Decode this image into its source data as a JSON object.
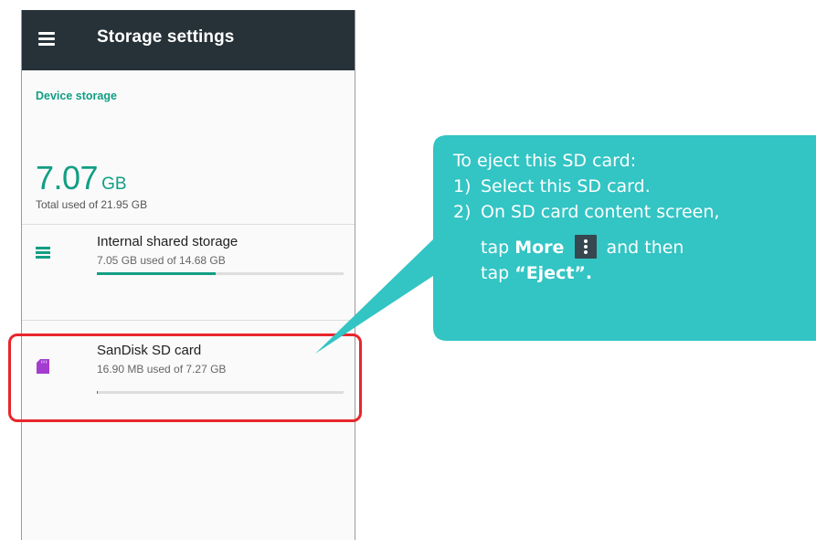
{
  "app_bar": {
    "menu_icon": "hamburger-menu-icon",
    "title": "Storage settings",
    "background": "#263238"
  },
  "device_storage": {
    "section_label": "Device storage",
    "total_value": "7.07",
    "total_unit": "GB",
    "total_subtitle": "Total used of 21.95 GB",
    "accent_color": "#129e85"
  },
  "storage_items": [
    {
      "icon": "storage-list-icon",
      "title": "Internal shared storage",
      "subtitle": "7.05 GB used of 14.68 GB",
      "usage_fraction": 0.48,
      "bar_color": "#129e85"
    },
    {
      "icon": "sd-card-icon",
      "title": "SanDisk SD card",
      "subtitle": "16.90 MB used of 7.27 GB",
      "usage_fraction": 0.002,
      "bar_color": "#a43ccf"
    }
  ],
  "annotation": {
    "highlight_color": "#e8262b",
    "callout_color": "#33c4c4",
    "heading": "To eject this SD card:",
    "step1_num": "1)",
    "step1_text": "Select this SD card.",
    "step2_num": "2)",
    "step2_text": "On SD card content screen,",
    "step2_cont_pre": "tap ",
    "step2_cont_bold": "More",
    "step2_more_icon": "more-vertical-icon",
    "step2_cont_post": " and then",
    "step2_cont2_pre": "tap ",
    "step2_cont2_bold": "“Eject”."
  }
}
